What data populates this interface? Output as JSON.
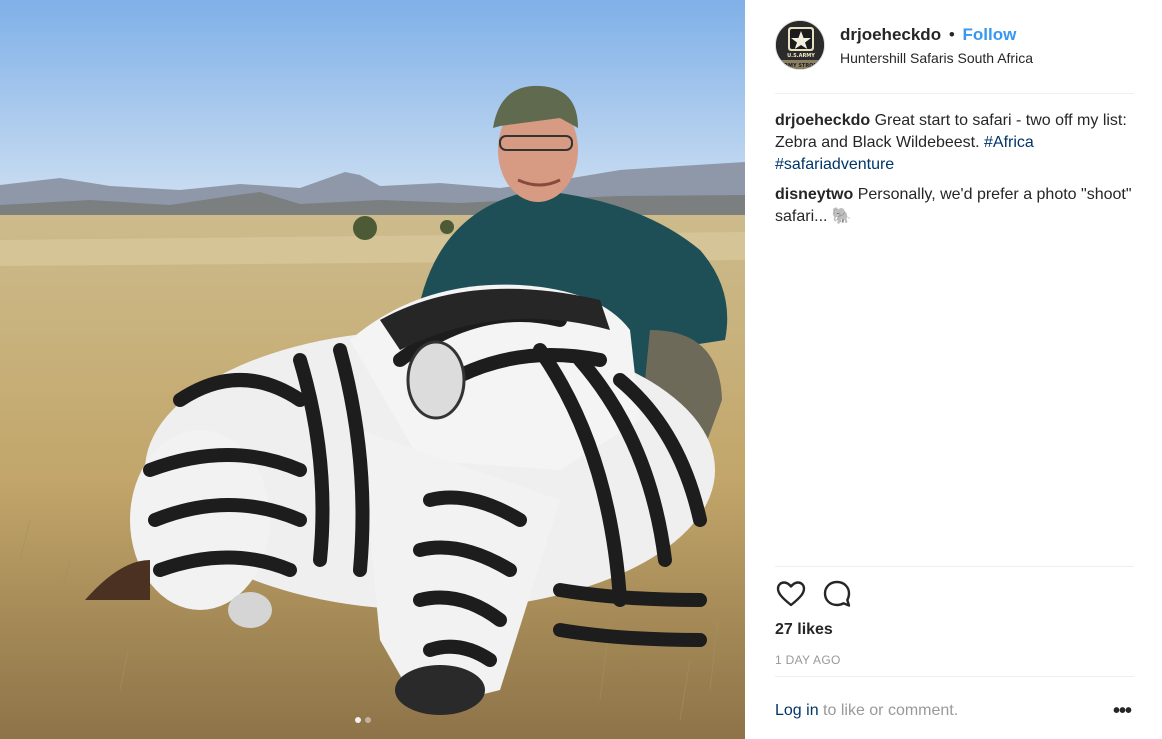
{
  "post": {
    "username": "drjoeheckdo",
    "separator": "•",
    "follow_label": "Follow",
    "location": "Huntershill Safaris South Africa",
    "avatar_icon": "us-army-star-logo",
    "avatar_text_line1": "U.S.ARMY",
    "avatar_text_line2": "ARMY STRONG"
  },
  "caption": {
    "username": "drjoeheckdo",
    "text": "Great start to safari - two off my list: Zebra and Black Wildebeest.",
    "hashtag1": "#Africa",
    "hashtag2": "#safariadventure"
  },
  "comment": {
    "username": "disneytwo",
    "text": "Personally, we'd prefer a photo \"shoot\" safari...",
    "emoji": "🐘"
  },
  "actions": {
    "like_icon": "heart-icon",
    "comment_icon": "comment-bubble-icon",
    "likes": "27 likes",
    "timestamp": "1 DAY AGO"
  },
  "footer": {
    "login_link": "Log in",
    "login_rest": " to like or comment.",
    "more_label": "•••"
  },
  "colors": {
    "follow_blue": "#3897f0",
    "hashtag_navy": "#003569",
    "muted_gray": "#999999"
  }
}
